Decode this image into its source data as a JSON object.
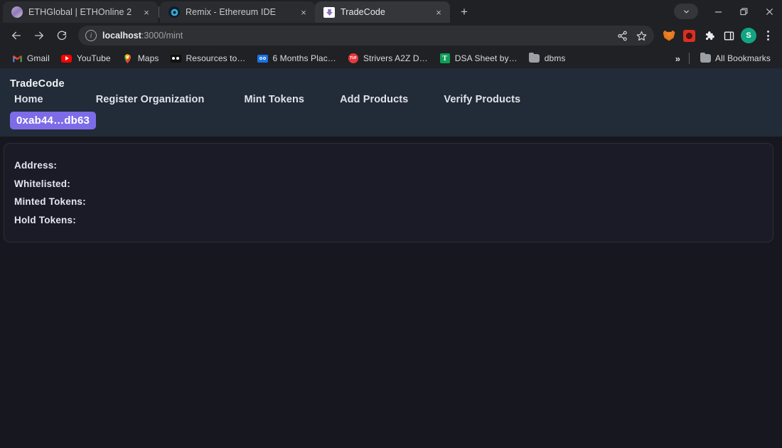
{
  "browser": {
    "tabs": [
      {
        "title": "ETHGlobal | ETHOnline 2",
        "favicon": "ethglobal-icon",
        "active": false,
        "close_label": "×"
      },
      {
        "title": "Remix - Ethereum IDE",
        "favicon": "remix-icon",
        "active": false,
        "close_label": "×"
      },
      {
        "title": "TradeCode",
        "favicon": "tradecode-icon",
        "active": true,
        "close_label": "×"
      }
    ],
    "new_tab_label": "+",
    "window_controls": {
      "tab_search": "tab-search-chevron",
      "minimize": "minimize",
      "maximize": "maximize",
      "close": "close"
    },
    "toolbar": {
      "back": "back-arrow",
      "forward": "forward-arrow",
      "reload": "reload",
      "site_info": "i",
      "url_host": "localhost",
      "url_path": ":3000/mint",
      "url_full": "localhost:3000/mint",
      "share": "share-icon",
      "bookmark_star": "star-icon",
      "extensions": [
        {
          "name": "metamask-extension-icon"
        },
        {
          "name": "red-extension-icon"
        },
        {
          "name": "puzzle-extensions-icon"
        },
        {
          "name": "side-panel-icon"
        }
      ],
      "profile_initial": "S",
      "menu": "chrome-menu-icon"
    },
    "bookmarks": [
      {
        "label": "Gmail",
        "icon": "gmail-icon"
      },
      {
        "label": "YouTube",
        "icon": "youtube-icon"
      },
      {
        "label": "Maps",
        "icon": "maps-icon"
      },
      {
        "label": "Resources to…",
        "icon": "resources-icon"
      },
      {
        "label": "6 Months Plac…",
        "icon": "infinity-icon"
      },
      {
        "label": "Strivers A2Z D…",
        "icon": "strivers-icon"
      },
      {
        "label": "DSA Sheet by…",
        "icon": "dsa-sheet-icon"
      },
      {
        "label": "dbms",
        "icon": "folder-icon"
      }
    ],
    "bookmarks_overflow": "»",
    "all_bookmarks_label": "All Bookmarks",
    "all_bookmarks_icon": "folder-icon"
  },
  "site": {
    "brand": "TradeCode",
    "nav": [
      {
        "label": "Home"
      },
      {
        "label": "Register Organization"
      },
      {
        "label": "Mint Tokens"
      },
      {
        "label": "Add Products"
      },
      {
        "label": "Verify Products"
      }
    ],
    "wallet": {
      "address_short": "0xab44…db63",
      "button_color": "#7c6ce8"
    },
    "info_card": {
      "rows": [
        {
          "label": "Address:",
          "value": ""
        },
        {
          "label": "Whitelisted:",
          "value": ""
        },
        {
          "label": "Minted Tokens:",
          "value": ""
        },
        {
          "label": "Hold Tokens:",
          "value": ""
        }
      ]
    }
  },
  "colors": {
    "chrome_bg": "#202124",
    "nav_bg": "#222b38",
    "page_bg": "#17171f",
    "card_bg": "#1b1b27",
    "accent_purple": "#7c6ce8",
    "avatar_green": "#12a482"
  }
}
